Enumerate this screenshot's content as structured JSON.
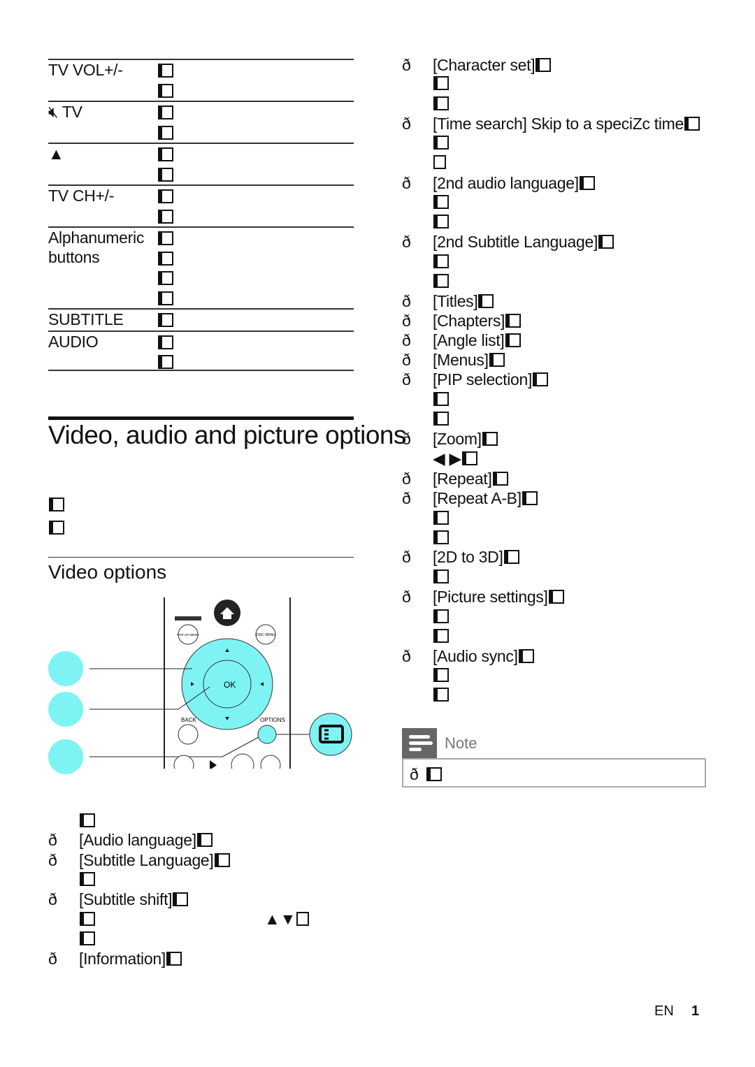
{
  "table": {
    "rows": [
      {
        "key": "TV VOL+/-",
        "lines": 2
      },
      {
        "key_icon": "mute-icon",
        "key": "TV",
        "lines": 2
      },
      {
        "key_icon": "eject-icon",
        "key": "▲",
        "lines": 2
      },
      {
        "key": "TV CH+/-",
        "lines": 2
      },
      {
        "key": "Alphanumeric buttons",
        "lines": 4
      },
      {
        "key": "SUBTITLE",
        "lines": 1
      },
      {
        "key": "AUDIO",
        "lines": 2
      }
    ]
  },
  "section": {
    "title": "Video, audio and picture options",
    "video_heading": "Video options"
  },
  "remote": {
    "back_label": "BACK",
    "options_label": "OPTIONS",
    "pop_menu_label": "POP UP MENU",
    "disc_menu_label": "DISC MENU"
  },
  "left_list": [
    {
      "text": ""
    },
    {
      "bullet": "ð",
      "text": "[Audio language]"
    },
    {
      "bullet": "ð",
      "text": "[Subtitle Language]"
    },
    {
      "text": ""
    },
    {
      "bullet": "ð",
      "text": "[Subtitle shift]"
    },
    {
      "text": "",
      "extra": "▲▼"
    },
    {
      "text": ""
    },
    {
      "bullet": "ð",
      "text": "[Information]"
    }
  ],
  "right_list": [
    {
      "bullet": "ð",
      "text": "[Character set]"
    },
    {
      "text": ""
    },
    {
      "text": ""
    },
    {
      "bullet": "ð",
      "text": "[Time search] Skip to a speciZc time"
    },
    {
      "text": ""
    },
    {
      "text": "",
      "empty": true
    },
    {
      "bullet": "ð",
      "text": "[2nd audio language]"
    },
    {
      "text": ""
    },
    {
      "text": ""
    },
    {
      "bullet": "ð",
      "text": "[2nd Subtitle Language]"
    },
    {
      "text": ""
    },
    {
      "text": ""
    },
    {
      "bullet": "ð",
      "text": "[Titles]"
    },
    {
      "bullet": "ð",
      "text": "[Chapters]"
    },
    {
      "bullet": "ð",
      "text": "[Angle list]"
    },
    {
      "bullet": "ð",
      "text": "[Menus]"
    },
    {
      "bullet": "ð",
      "text": "[PIP selection]"
    },
    {
      "text": ""
    },
    {
      "text": ""
    },
    {
      "bullet": "ð",
      "text": "[Zoom]"
    },
    {
      "text": "◀ ▶"
    },
    {
      "bullet": "ð",
      "text": "[Repeat]"
    },
    {
      "bullet": "ð",
      "text": "[Repeat A-B]"
    },
    {
      "text": ""
    },
    {
      "text": ""
    },
    {
      "bullet": "ð",
      "text": "[2D to 3D]"
    },
    {
      "text": ""
    },
    {
      "bullet": "ð",
      "text": "[Picture settings]"
    },
    {
      "text": ""
    },
    {
      "text": ""
    },
    {
      "bullet": "ð",
      "text": "[Audio sync]"
    },
    {
      "text": ""
    },
    {
      "text": ""
    }
  ],
  "note": {
    "title": "Note",
    "bullet": "ð"
  },
  "footer": {
    "lang": "EN",
    "page": "1"
  },
  "colors": {
    "accent": "#7ef3f3",
    "note_header": "#666666"
  }
}
